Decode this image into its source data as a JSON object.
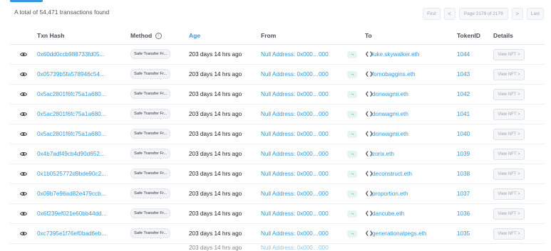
{
  "summary": "A total of 54,471 transactions found",
  "pagination": {
    "first": "First",
    "prev": "<",
    "page": "Page 2179 of 2179",
    "next": ">",
    "last": "Last"
  },
  "columns": {
    "txn_hash": "Txn Hash",
    "method": "Method",
    "method_info": "i",
    "age": "Age",
    "from": "From",
    "to": "To",
    "token_id": "TokenID",
    "details": "Details"
  },
  "arrow_symbol": "→",
  "contract_symbol": "❮❯",
  "rows": [
    {
      "hash": "0x60dd0ccb988733fd05...",
      "method": "Safe Transfer Fr...",
      "age": "203 days 14 hrs ago",
      "from": "Null Address: 0x000…000",
      "to": "luke.skywalker.eth",
      "token": "1044",
      "details": "View NFT >"
    },
    {
      "hash": "0x05739b5fa578946c54...",
      "method": "Safe Transfer Fr...",
      "age": "203 days 14 hrs ago",
      "from": "Null Address: 0x000…000",
      "to": "fomobaggins.eth",
      "token": "1043",
      "details": "View NFT >"
    },
    {
      "hash": "0x5ac2801f6fc75a1a680...",
      "method": "Safe Transfer Fr...",
      "age": "203 days 14 hrs ago",
      "from": "Null Address: 0x000…000",
      "to": "donwagmi.eth",
      "token": "1042",
      "details": "View NFT >"
    },
    {
      "hash": "0x5ac2801f6fc75a1a680...",
      "method": "Safe Transfer Fr...",
      "age": "203 days 14 hrs ago",
      "from": "Null Address: 0x000…000",
      "to": "donwagmi.eth",
      "token": "1041",
      "details": "View NFT >"
    },
    {
      "hash": "0x5ac2801f6fc75a1a680...",
      "method": "Safe Transfer Fr...",
      "age": "203 days 14 hrs ago",
      "from": "Null Address: 0x000…000",
      "to": "donwagmi.eth",
      "token": "1040",
      "details": "View NFT >"
    },
    {
      "hash": "0x4b7adf49cb4d90d652...",
      "method": "Safe Transfer Fr...",
      "age": "203 days 14 hrs ago",
      "from": "Null Address: 0x000…000",
      "to": "zorix.eth",
      "token": "1039",
      "details": "View NFT >"
    },
    {
      "hash": "0x1b0525772d9bde90c2...",
      "method": "Safe Transfer Fr...",
      "age": "203 days 14 hrs ago",
      "from": "Null Address: 0x000…000",
      "to": "deconstruct.eth",
      "token": "1038",
      "details": "View NFT >"
    },
    {
      "hash": "0x09b7e96ad82e479ccb...",
      "method": "Safe Transfer Fr...",
      "age": "203 days 14 hrs ago",
      "from": "Null Address: 0x000…000",
      "to": "proportion.eth",
      "token": "1037",
      "details": "View NFT >"
    },
    {
      "hash": "0x6f239ef021e60bb44dd...",
      "method": "Safe Transfer Fr...",
      "age": "203 days 14 hrs ago",
      "from": "Null Address: 0x000…000",
      "to": "dancube.eth",
      "token": "1036",
      "details": "View NFT >"
    },
    {
      "hash": "0xc7395e1f76ef0bad6eb...",
      "method": "Safe Transfer Fr...",
      "age": "203 days 14 hrs ago",
      "from": "Null Address: 0x000…000",
      "to": "generationalpegs.eth",
      "token": "1035",
      "details": "View NFT >"
    }
  ],
  "partial_row": {
    "age": "203 days 14 hrs ago",
    "from": "Null Address: 0x000…000"
  },
  "colors": {
    "link": "#3498db",
    "accent": "#3498db",
    "arrow": "#00a186"
  }
}
